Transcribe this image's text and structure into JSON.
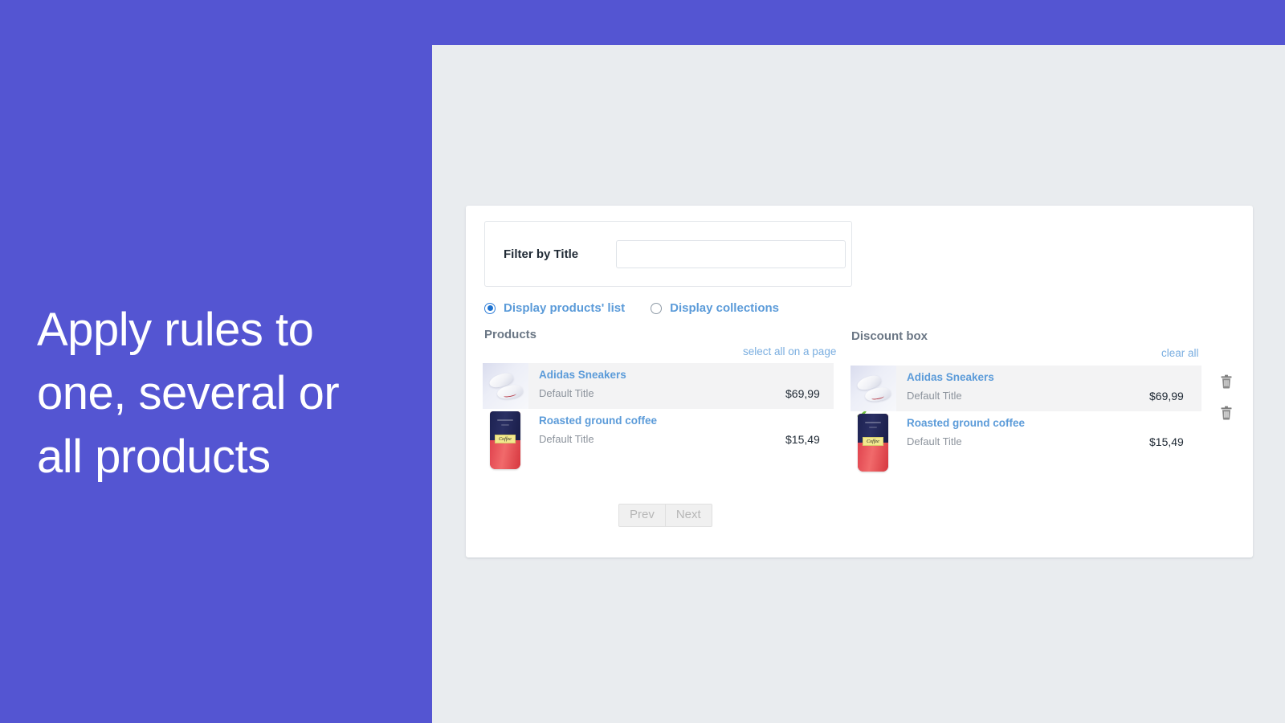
{
  "hero": {
    "headline": "Apply rules to\none, several or\nall products",
    "bg_color": "#5455d2"
  },
  "card": {
    "filter": {
      "label": "Filter by Title",
      "value": "",
      "placeholder": ""
    },
    "display_mode": {
      "options": [
        {
          "label": "Display products' list",
          "selected": true
        },
        {
          "label": "Display collections",
          "selected": false
        }
      ]
    },
    "products_column": {
      "title": "Products",
      "action_link": "select all on a page",
      "items": [
        {
          "title": "Adidas Sneakers",
          "variant": "Default Title",
          "price": "$69,99",
          "thumb": "sneakers-image",
          "status_icon": "check-icon",
          "selected": true
        },
        {
          "title": "Roasted ground coffee",
          "variant": "Default Title",
          "price": "$15,49",
          "thumb": "coffee-bag-image",
          "status_icon": "check-icon",
          "selected": false
        }
      ]
    },
    "discount_column": {
      "title": "Discount box",
      "action_link": "clear all",
      "items": [
        {
          "title": "Adidas Sneakers",
          "variant": "Default Title",
          "price": "$69,99",
          "thumb": "sneakers-image",
          "action_icon": "trash-icon",
          "selected": true
        },
        {
          "title": "Roasted ground coffee",
          "variant": "Default Title",
          "price": "$15,49",
          "thumb": "coffee-bag-image",
          "action_icon": "trash-icon",
          "selected": false
        }
      ]
    },
    "pagination": {
      "prev_label": "Prev",
      "next_label": "Next"
    }
  },
  "colors": {
    "purple": "#5455d2",
    "workspace": "#e9ecef",
    "link_blue": "#5b9bd9",
    "check_green": "#72c040",
    "muted_gray": "#8c939c"
  },
  "thumbs": {
    "coffee_label_text": "Coffee"
  }
}
